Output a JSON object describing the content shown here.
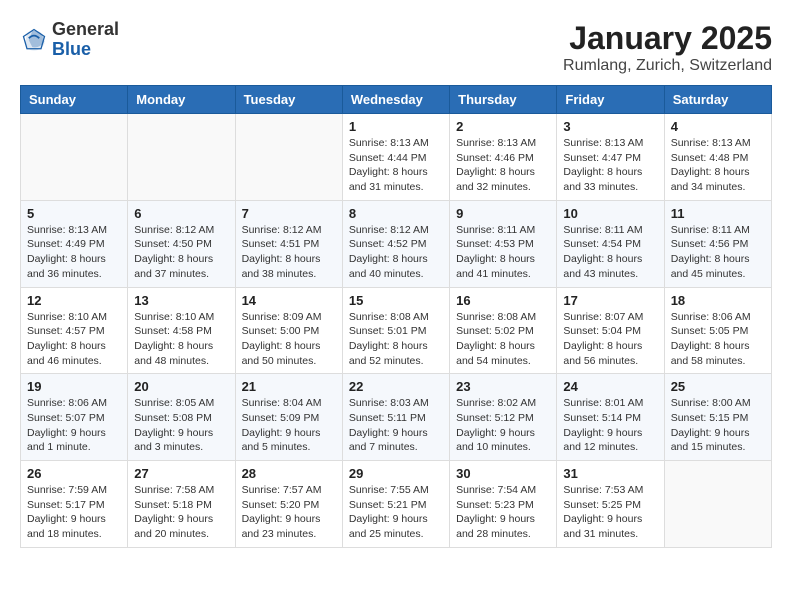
{
  "header": {
    "logo_general": "General",
    "logo_blue": "Blue",
    "title": "January 2025",
    "subtitle": "Rumlang, Zurich, Switzerland"
  },
  "days_of_week": [
    "Sunday",
    "Monday",
    "Tuesday",
    "Wednesday",
    "Thursday",
    "Friday",
    "Saturday"
  ],
  "weeks": [
    [
      {
        "day": "",
        "info": ""
      },
      {
        "day": "",
        "info": ""
      },
      {
        "day": "",
        "info": ""
      },
      {
        "day": "1",
        "info": "Sunrise: 8:13 AM\nSunset: 4:44 PM\nDaylight: 8 hours\nand 31 minutes."
      },
      {
        "day": "2",
        "info": "Sunrise: 8:13 AM\nSunset: 4:46 PM\nDaylight: 8 hours\nand 32 minutes."
      },
      {
        "day": "3",
        "info": "Sunrise: 8:13 AM\nSunset: 4:47 PM\nDaylight: 8 hours\nand 33 minutes."
      },
      {
        "day": "4",
        "info": "Sunrise: 8:13 AM\nSunset: 4:48 PM\nDaylight: 8 hours\nand 34 minutes."
      }
    ],
    [
      {
        "day": "5",
        "info": "Sunrise: 8:13 AM\nSunset: 4:49 PM\nDaylight: 8 hours\nand 36 minutes."
      },
      {
        "day": "6",
        "info": "Sunrise: 8:12 AM\nSunset: 4:50 PM\nDaylight: 8 hours\nand 37 minutes."
      },
      {
        "day": "7",
        "info": "Sunrise: 8:12 AM\nSunset: 4:51 PM\nDaylight: 8 hours\nand 38 minutes."
      },
      {
        "day": "8",
        "info": "Sunrise: 8:12 AM\nSunset: 4:52 PM\nDaylight: 8 hours\nand 40 minutes."
      },
      {
        "day": "9",
        "info": "Sunrise: 8:11 AM\nSunset: 4:53 PM\nDaylight: 8 hours\nand 41 minutes."
      },
      {
        "day": "10",
        "info": "Sunrise: 8:11 AM\nSunset: 4:54 PM\nDaylight: 8 hours\nand 43 minutes."
      },
      {
        "day": "11",
        "info": "Sunrise: 8:11 AM\nSunset: 4:56 PM\nDaylight: 8 hours\nand 45 minutes."
      }
    ],
    [
      {
        "day": "12",
        "info": "Sunrise: 8:10 AM\nSunset: 4:57 PM\nDaylight: 8 hours\nand 46 minutes."
      },
      {
        "day": "13",
        "info": "Sunrise: 8:10 AM\nSunset: 4:58 PM\nDaylight: 8 hours\nand 48 minutes."
      },
      {
        "day": "14",
        "info": "Sunrise: 8:09 AM\nSunset: 5:00 PM\nDaylight: 8 hours\nand 50 minutes."
      },
      {
        "day": "15",
        "info": "Sunrise: 8:08 AM\nSunset: 5:01 PM\nDaylight: 8 hours\nand 52 minutes."
      },
      {
        "day": "16",
        "info": "Sunrise: 8:08 AM\nSunset: 5:02 PM\nDaylight: 8 hours\nand 54 minutes."
      },
      {
        "day": "17",
        "info": "Sunrise: 8:07 AM\nSunset: 5:04 PM\nDaylight: 8 hours\nand 56 minutes."
      },
      {
        "day": "18",
        "info": "Sunrise: 8:06 AM\nSunset: 5:05 PM\nDaylight: 8 hours\nand 58 minutes."
      }
    ],
    [
      {
        "day": "19",
        "info": "Sunrise: 8:06 AM\nSunset: 5:07 PM\nDaylight: 9 hours\nand 1 minute."
      },
      {
        "day": "20",
        "info": "Sunrise: 8:05 AM\nSunset: 5:08 PM\nDaylight: 9 hours\nand 3 minutes."
      },
      {
        "day": "21",
        "info": "Sunrise: 8:04 AM\nSunset: 5:09 PM\nDaylight: 9 hours\nand 5 minutes."
      },
      {
        "day": "22",
        "info": "Sunrise: 8:03 AM\nSunset: 5:11 PM\nDaylight: 9 hours\nand 7 minutes."
      },
      {
        "day": "23",
        "info": "Sunrise: 8:02 AM\nSunset: 5:12 PM\nDaylight: 9 hours\nand 10 minutes."
      },
      {
        "day": "24",
        "info": "Sunrise: 8:01 AM\nSunset: 5:14 PM\nDaylight: 9 hours\nand 12 minutes."
      },
      {
        "day": "25",
        "info": "Sunrise: 8:00 AM\nSunset: 5:15 PM\nDaylight: 9 hours\nand 15 minutes."
      }
    ],
    [
      {
        "day": "26",
        "info": "Sunrise: 7:59 AM\nSunset: 5:17 PM\nDaylight: 9 hours\nand 18 minutes."
      },
      {
        "day": "27",
        "info": "Sunrise: 7:58 AM\nSunset: 5:18 PM\nDaylight: 9 hours\nand 20 minutes."
      },
      {
        "day": "28",
        "info": "Sunrise: 7:57 AM\nSunset: 5:20 PM\nDaylight: 9 hours\nand 23 minutes."
      },
      {
        "day": "29",
        "info": "Sunrise: 7:55 AM\nSunset: 5:21 PM\nDaylight: 9 hours\nand 25 minutes."
      },
      {
        "day": "30",
        "info": "Sunrise: 7:54 AM\nSunset: 5:23 PM\nDaylight: 9 hours\nand 28 minutes."
      },
      {
        "day": "31",
        "info": "Sunrise: 7:53 AM\nSunset: 5:25 PM\nDaylight: 9 hours\nand 31 minutes."
      },
      {
        "day": "",
        "info": ""
      }
    ]
  ]
}
